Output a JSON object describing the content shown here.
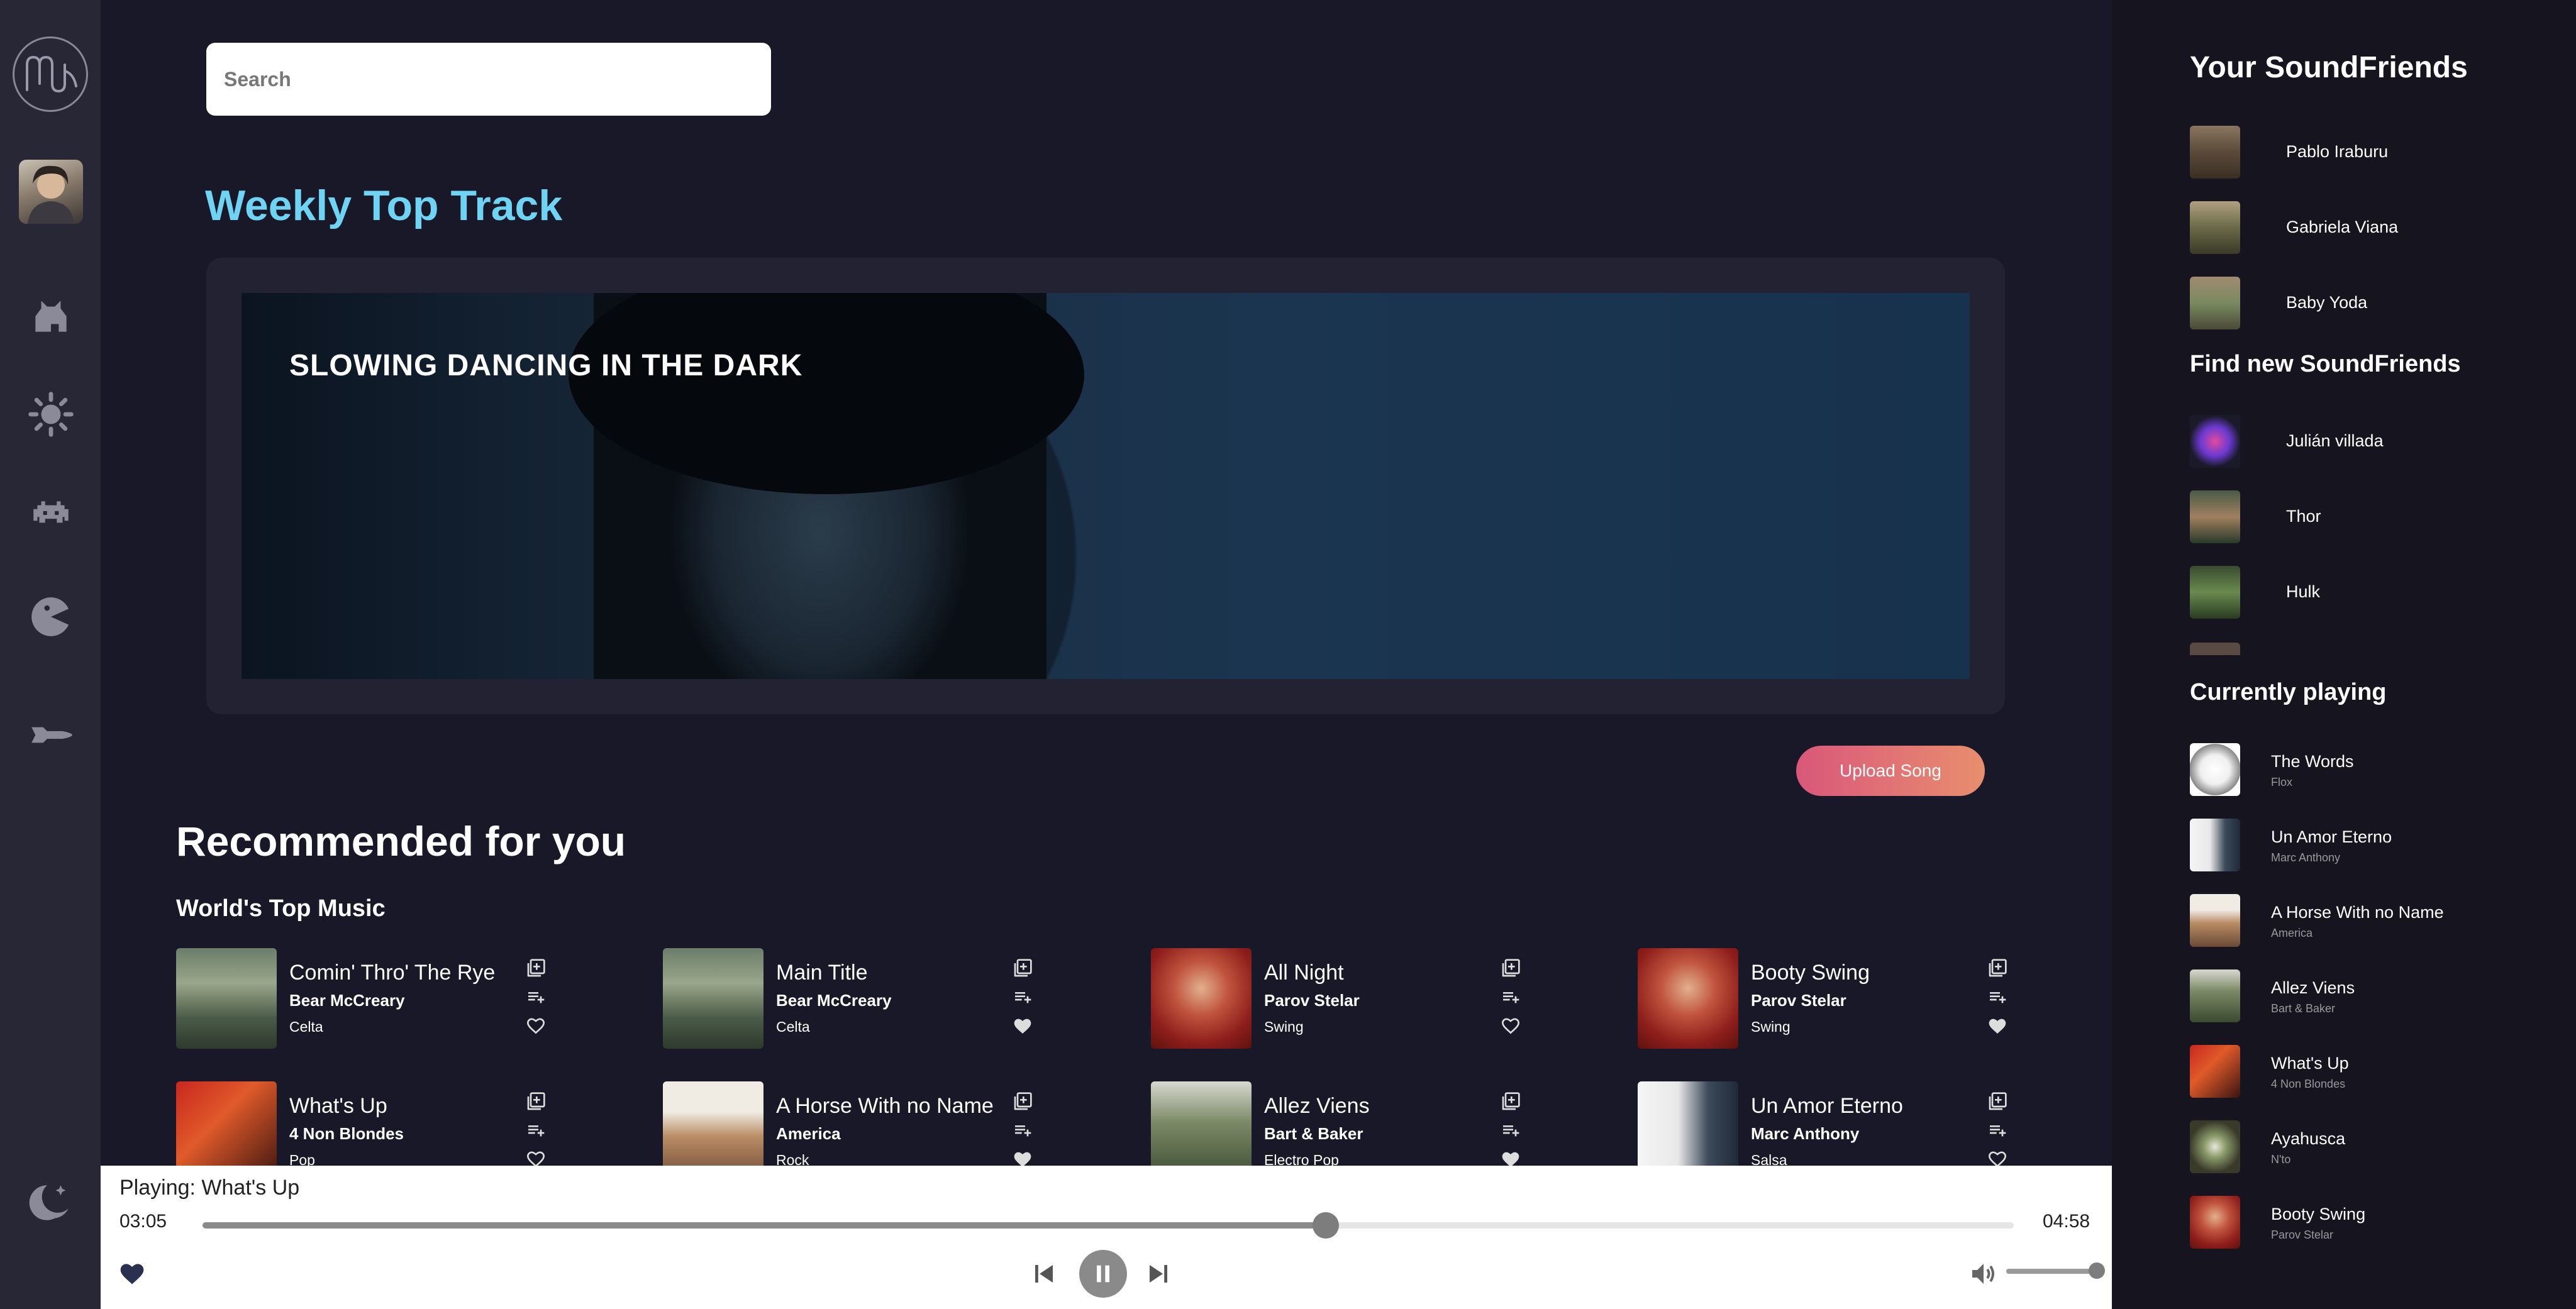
{
  "search": {
    "placeholder": "Search"
  },
  "weekly": {
    "title": "Weekly Top Track",
    "track": "SLOWING DANCING IN THE DARK"
  },
  "upload_label": "Upload Song",
  "recommended": {
    "title": "Recommended for you",
    "section": "World's Top Music",
    "cards": [
      {
        "title": "Comin' Thro' The Rye",
        "artist": "Bear McCreary",
        "genre": "Celta",
        "liked": false
      },
      {
        "title": "Main Title",
        "artist": "Bear McCreary",
        "genre": "Celta",
        "liked": true
      },
      {
        "title": "All Night",
        "artist": "Parov Stelar",
        "genre": "Swing",
        "liked": false
      },
      {
        "title": "Booty Swing",
        "artist": "Parov Stelar",
        "genre": "Swing",
        "liked": true
      },
      {
        "title": "What's Up",
        "artist": "4 Non Blondes",
        "genre": "Pop",
        "liked": false
      },
      {
        "title": "A Horse With no Name",
        "artist": "America",
        "genre": "Rock",
        "liked": true
      },
      {
        "title": "Allez Viens",
        "artist": "Bart & Baker",
        "genre": "Electro Pop",
        "liked": true
      },
      {
        "title": "Un Amor Eterno",
        "artist": "Marc Anthony",
        "genre": "Salsa",
        "liked": false
      }
    ]
  },
  "player": {
    "now_playing": "Playing: What's Up",
    "current_time": "03:05",
    "duration": "04:58",
    "progress_fraction": 0.62,
    "volume_fraction": 1.0
  },
  "friends": {
    "title": "Your SoundFriends",
    "items": [
      {
        "name": "Pablo Iraburu"
      },
      {
        "name": "Gabriela Viana"
      },
      {
        "name": "Baby Yoda"
      }
    ]
  },
  "find": {
    "title": "Find new SoundFriends",
    "items": [
      {
        "name": "Julián villada"
      },
      {
        "name": "Thor"
      },
      {
        "name": "Hulk"
      }
    ]
  },
  "queue": {
    "title": "Currently playing",
    "items": [
      {
        "title": "The Words",
        "artist": "Flox"
      },
      {
        "title": "Un Amor Eterno",
        "artist": "Marc Anthony"
      },
      {
        "title": "A Horse With no Name",
        "artist": "America"
      },
      {
        "title": "Allez Viens",
        "artist": "Bart & Baker"
      },
      {
        "title": "What's Up",
        "artist": "4 Non Blondes"
      },
      {
        "title": "Ayahusca",
        "artist": "N'to"
      },
      {
        "title": "Booty Swing",
        "artist": "Parov Stelar"
      }
    ]
  },
  "colors": {
    "accent": "#6fd4f4",
    "upload_start": "#d9577a",
    "upload_end": "#e88e6e",
    "background": "#191828"
  },
  "icons": [
    "app-logo-icon",
    "cat-icon",
    "sun-icon",
    "invader-icon",
    "pacman-icon",
    "spaceship-icon",
    "moon-stars-icon",
    "library-add-icon",
    "playlist-add-icon",
    "heart-icon",
    "remove-friend-icon",
    "add-friend-icon",
    "remove-from-queue-icon",
    "skip-previous-icon",
    "pause-icon",
    "skip-next-icon",
    "volume-icon"
  ]
}
